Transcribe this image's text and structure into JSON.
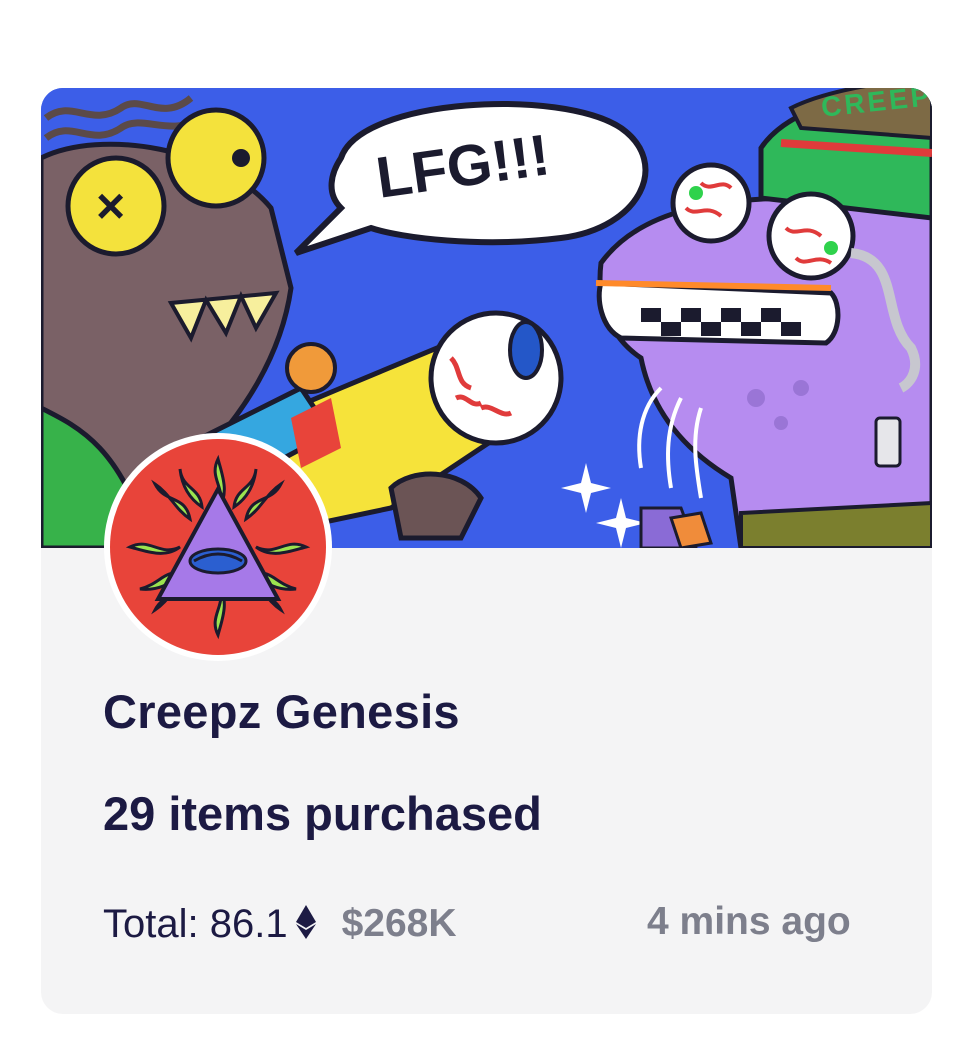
{
  "collection": {
    "name": "Creepz Genesis",
    "items_purchased": "29 items purchased",
    "total_label": "Total: 86.1",
    "currency_icon": "ethereum-icon",
    "usd_value": "$268K",
    "time_ago": "4 mins ago",
    "banner_speech": "LFG!!!",
    "banner_hat_text": "CREEP"
  },
  "colors": {
    "card_bg": "#f4f4f5",
    "banner_bg": "#3c5ee8",
    "title_text": "#1c1a43",
    "muted_text": "#7d7f8c",
    "avatar_bg": "#e8443a"
  }
}
